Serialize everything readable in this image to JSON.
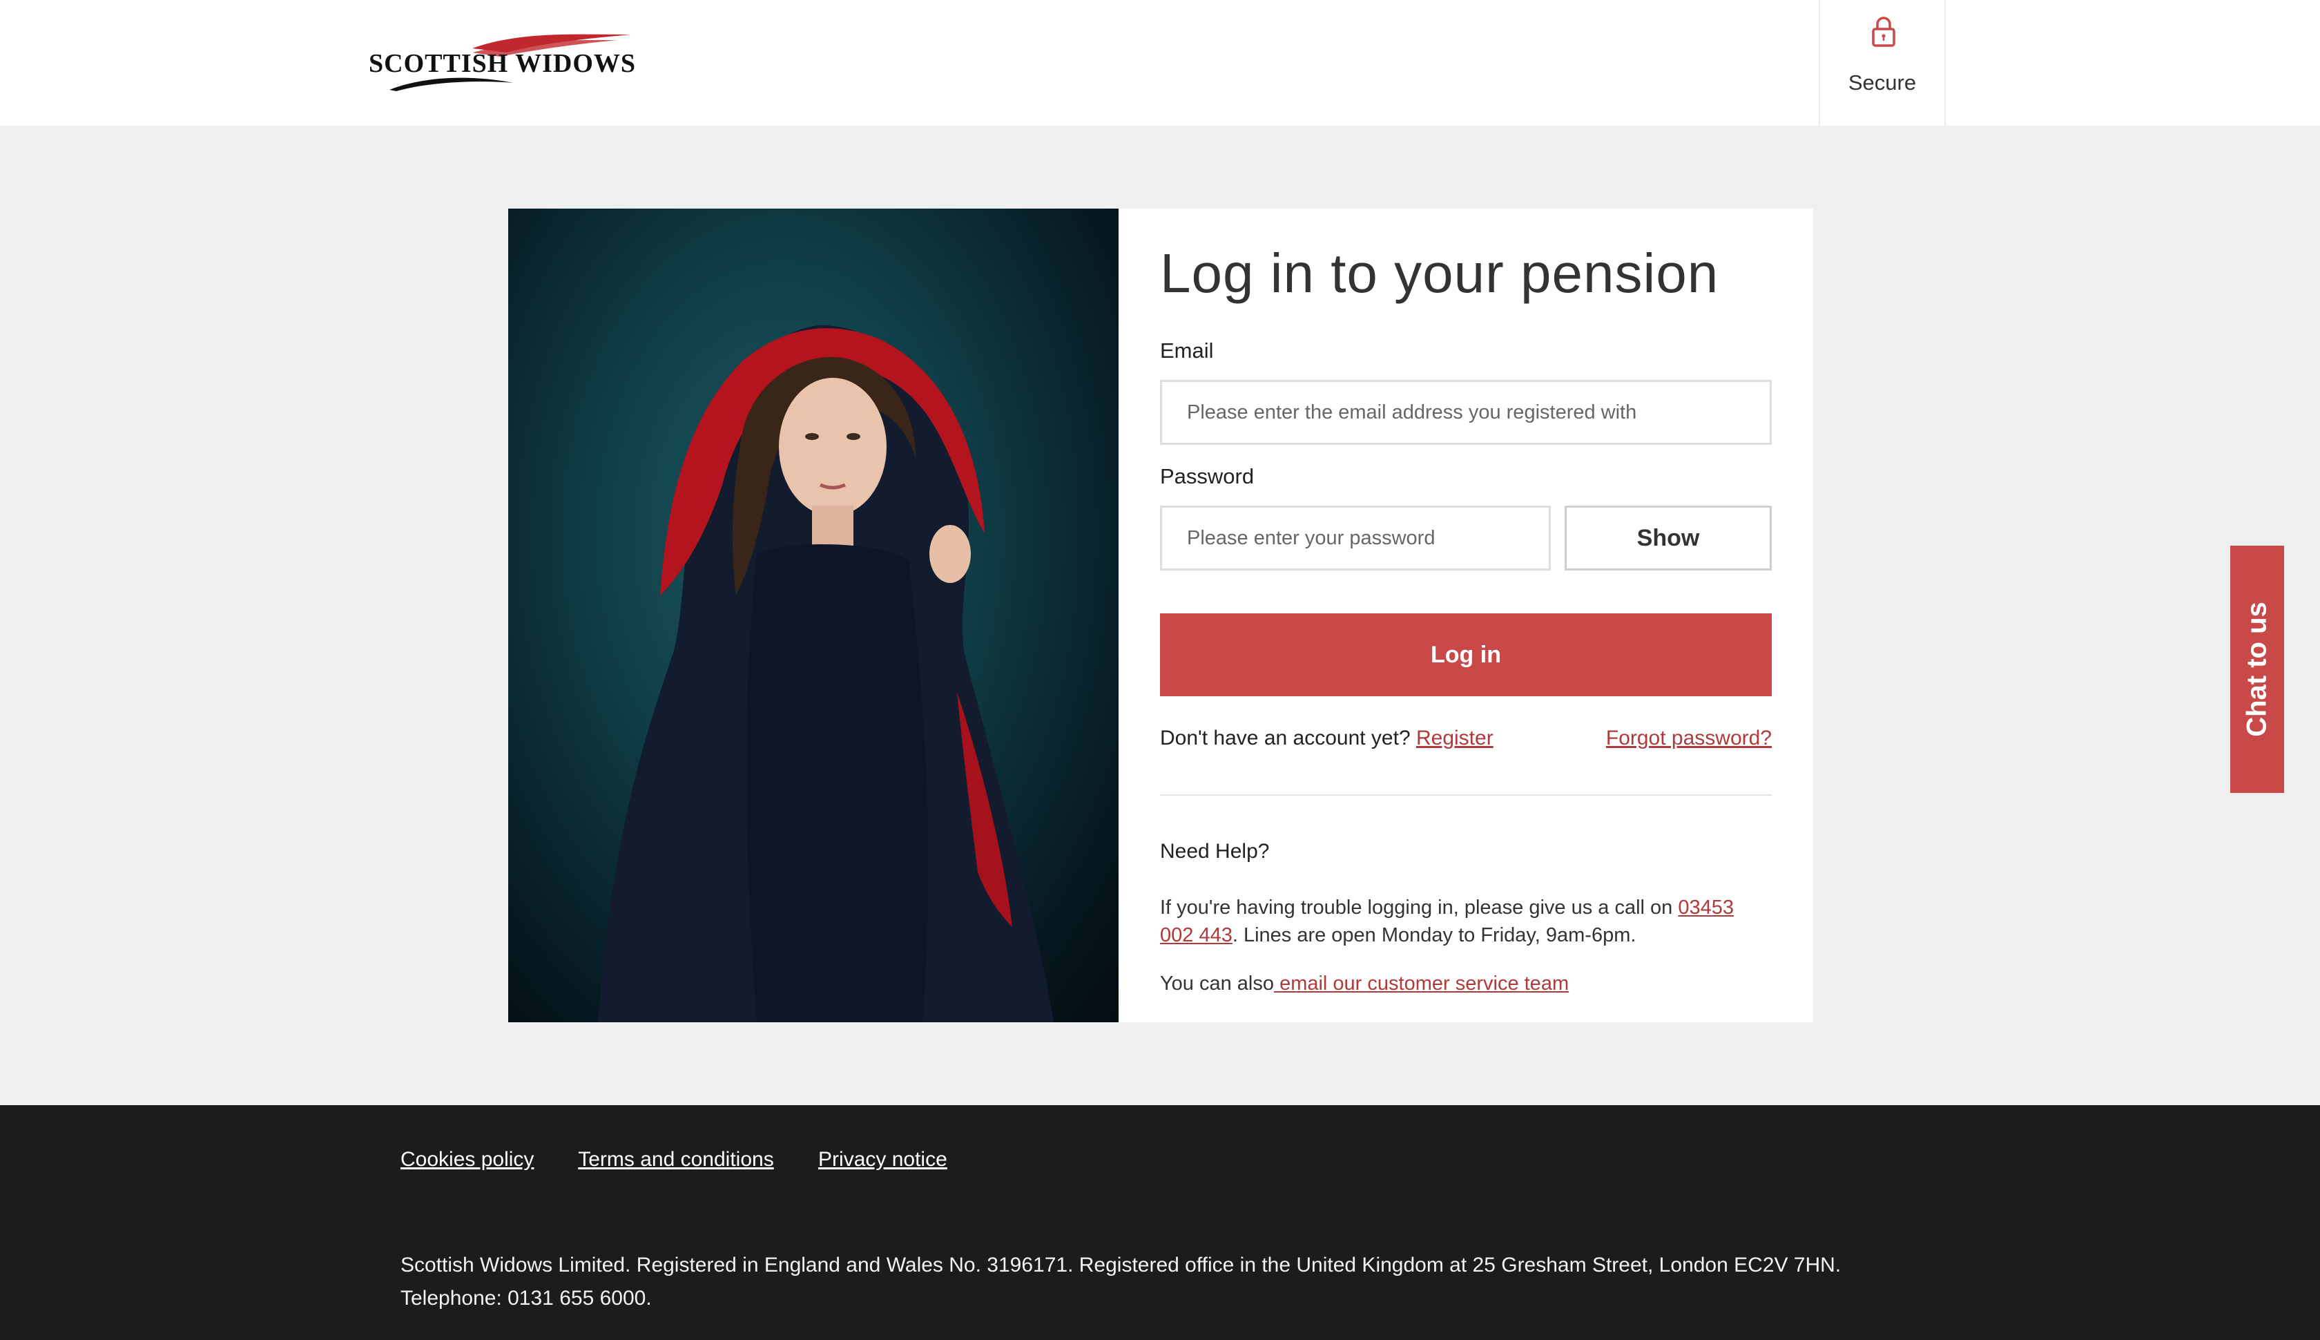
{
  "header": {
    "logo_text": "SCOTTISH WIDOWS",
    "secure_label": "Secure",
    "secure_icon": "padlock-icon"
  },
  "colors": {
    "brand_red": "#c94949",
    "link_red": "#b03a3a",
    "footer_bg": "#1c1c1c",
    "page_bg": "#efefef"
  },
  "login": {
    "title": "Log in to your pension",
    "email_label": "Email",
    "email_placeholder": "Please enter the email address you registered with",
    "email_value": "",
    "password_label": "Password",
    "password_placeholder": "Please enter your password",
    "password_value": "",
    "show_label": "Show",
    "login_label": "Log in",
    "no_account_text": "Don't have an account yet?",
    "register_label": "Register",
    "forgot_label": "Forgot password?"
  },
  "help": {
    "title": "Need Help?",
    "text_before_phone": "If you're having trouble logging in, please give us a call on ",
    "phone": "03453 002 443",
    "text_after_phone": ". Lines are open Monday to Friday, 9am-6pm.",
    "email_prefix": "You can also",
    "email_link": " email our customer service team"
  },
  "chat": {
    "label": "Chat to us"
  },
  "footer": {
    "links": [
      "Cookies policy",
      "Terms and conditions",
      "Privacy notice"
    ],
    "legal": "Scottish Widows Limited. Registered in England and Wales No. 3196171. Registered office in the United Kingdom at 25 Gresham Street, London EC2V 7HN. Telephone: 0131 655 6000."
  }
}
